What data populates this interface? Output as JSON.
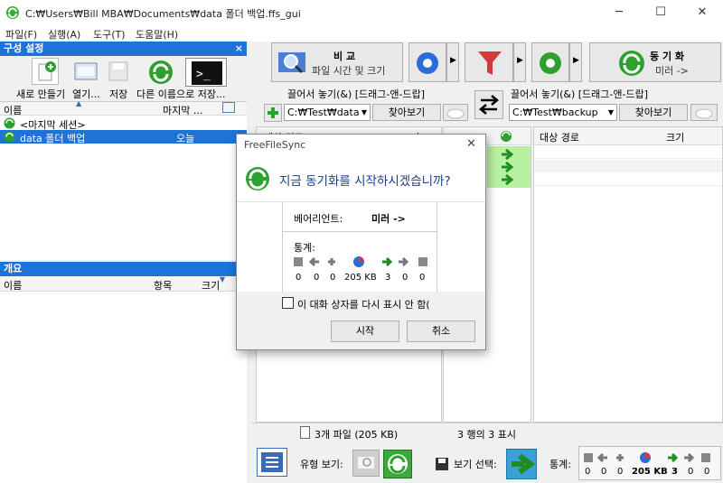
{
  "window": {
    "title": "C:₩Users₩Bill MBA₩Documents₩data 폴더 백업.ffs_gui",
    "minimize": "─",
    "maximize": "☐",
    "close": "✕"
  },
  "menu": [
    "파일(F)",
    "실행(A)",
    "도구(T)",
    "도움말(H)"
  ],
  "config_panel": {
    "title": "구성 설정",
    "close": "×",
    "toolbar": [
      "새로 만들기",
      "열기...",
      "저장",
      "다른 이름으로 저장..."
    ],
    "columns": {
      "name": "이름",
      "last": "마지막 ..."
    },
    "items": [
      {
        "name": "<마지막 세션>",
        "last": ""
      },
      {
        "name": "data 폴더 백업",
        "last": "오늘"
      }
    ]
  },
  "overview_panel": {
    "title": "개요",
    "close": "×",
    "columns": {
      "name": "이름",
      "items": "항목",
      "size": "크기"
    }
  },
  "compare": {
    "label": "비 교",
    "sub": "파일 시간 및 크기"
  },
  "sync": {
    "label": "동 기 화",
    "sub": "미러 ->"
  },
  "left_folder": {
    "drop_label": "끌어서 놓기(&) [드래그-앤-드랍]",
    "path": "C:₩Test₩data",
    "browse": "찾아보기"
  },
  "right_folder": {
    "drop_label": "끌어서 놓기(&) [드래그-앤-드랍]",
    "path": "C:₩Test₩backup",
    "browse": "찾아보기"
  },
  "grid": {
    "left_col_name": "대상 경로",
    "left_col_size": "크기",
    "right_col_name": "대상 경로",
    "right_col_size": "크기"
  },
  "statusbar": {
    "left": "3개 파일 (205 KB)",
    "middle": "3 행의 3 표시"
  },
  "bottom": {
    "view_type": "유형 보기:",
    "view_select": "보기 선택:",
    "stats": "통계:",
    "stat_values": [
      "0",
      "0",
      "0",
      "205 KB",
      "3",
      "0",
      "0"
    ]
  },
  "dialog": {
    "title": "FreeFileSync",
    "close": "✕",
    "question": "지금 동기화를 시작하시겠습니까?",
    "variant_label": "베어리언트:",
    "variant_value": "미러 ->",
    "stats_label": "통계:",
    "stat_values": [
      "0",
      "0",
      "0",
      "205 KB",
      "3",
      "0",
      "0"
    ],
    "dont_show": "이 대화 상자를 다시 표시 안 함(",
    "start": "시작",
    "cancel": "취소"
  },
  "colors": {
    "accent": "#1e73d8",
    "green": "#2ea02e",
    "selected": "#1e73d8"
  }
}
